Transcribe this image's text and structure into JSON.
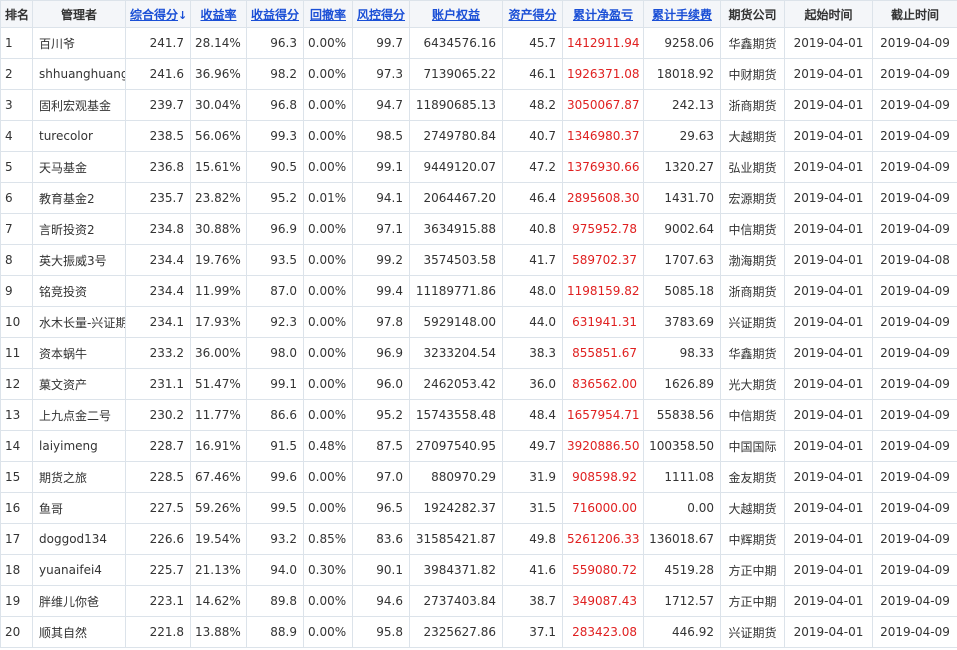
{
  "headers": {
    "rank": "排名",
    "manager": "管理者",
    "score": "综合得分",
    "return_rate": "收益率",
    "return_score": "收益得分",
    "drawdown": "回撤率",
    "risk_score": "风控得分",
    "equity": "账户权益",
    "asset_score": "资产得分",
    "profit": "累计净盈亏",
    "fees": "累计手续费",
    "broker": "期货公司",
    "start": "起始时间",
    "end": "截止时间",
    "sort_arrow": "↓"
  },
  "colors": {
    "link": "#1a4fd6",
    "profit": "#e02020",
    "grid": "#dce3ea"
  },
  "rows": [
    {
      "rank": "1",
      "manager": "百川爷",
      "score": "241.7",
      "return_rate": "28.14%",
      "return_score": "96.3",
      "drawdown": "0.00%",
      "risk_score": "99.7",
      "equity": "6434576.16",
      "asset_score": "45.7",
      "profit": "1412911.94",
      "fees": "9258.06",
      "broker": "华鑫期货",
      "start": "2019-04-01",
      "end": "2019-04-09"
    },
    {
      "rank": "2",
      "manager": "shhuanghuang",
      "score": "241.6",
      "return_rate": "36.96%",
      "return_score": "98.2",
      "drawdown": "0.00%",
      "risk_score": "97.3",
      "equity": "7139065.22",
      "asset_score": "46.1",
      "profit": "1926371.08",
      "fees": "18018.92",
      "broker": "中财期货",
      "start": "2019-04-01",
      "end": "2019-04-09"
    },
    {
      "rank": "3",
      "manager": "固利宏观基金",
      "score": "239.7",
      "return_rate": "30.04%",
      "return_score": "96.8",
      "drawdown": "0.00%",
      "risk_score": "94.7",
      "equity": "11890685.13",
      "asset_score": "48.2",
      "profit": "3050067.87",
      "fees": "242.13",
      "broker": "浙商期货",
      "start": "2019-04-01",
      "end": "2019-04-09"
    },
    {
      "rank": "4",
      "manager": "turecolor",
      "score": "238.5",
      "return_rate": "56.06%",
      "return_score": "99.3",
      "drawdown": "0.00%",
      "risk_score": "98.5",
      "equity": "2749780.84",
      "asset_score": "40.7",
      "profit": "1346980.37",
      "fees": "29.63",
      "broker": "大越期货",
      "start": "2019-04-01",
      "end": "2019-04-09"
    },
    {
      "rank": "5",
      "manager": "天马基金",
      "score": "236.8",
      "return_rate": "15.61%",
      "return_score": "90.5",
      "drawdown": "0.00%",
      "risk_score": "99.1",
      "equity": "9449120.07",
      "asset_score": "47.2",
      "profit": "1376930.66",
      "fees": "1320.27",
      "broker": "弘业期货",
      "start": "2019-04-01",
      "end": "2019-04-09"
    },
    {
      "rank": "6",
      "manager": "教育基金2",
      "score": "235.7",
      "return_rate": "23.82%",
      "return_score": "95.2",
      "drawdown": "0.01%",
      "risk_score": "94.1",
      "equity": "2064467.20",
      "asset_score": "46.4",
      "profit": "2895608.30",
      "fees": "1431.70",
      "broker": "宏源期货",
      "start": "2019-04-01",
      "end": "2019-04-09"
    },
    {
      "rank": "7",
      "manager": "言昕投资2",
      "score": "234.8",
      "return_rate": "30.88%",
      "return_score": "96.9",
      "drawdown": "0.00%",
      "risk_score": "97.1",
      "equity": "3634915.88",
      "asset_score": "40.8",
      "profit": "975952.78",
      "fees": "9002.64",
      "broker": "中信期货",
      "start": "2019-04-01",
      "end": "2019-04-09"
    },
    {
      "rank": "8",
      "manager": "英大振威3号",
      "score": "234.4",
      "return_rate": "19.76%",
      "return_score": "93.5",
      "drawdown": "0.00%",
      "risk_score": "99.2",
      "equity": "3574503.58",
      "asset_score": "41.7",
      "profit": "589702.37",
      "fees": "1707.63",
      "broker": "渤海期货",
      "start": "2019-04-01",
      "end": "2019-04-08"
    },
    {
      "rank": "9",
      "manager": "铭竞投资",
      "score": "234.4",
      "return_rate": "11.99%",
      "return_score": "87.0",
      "drawdown": "0.00%",
      "risk_score": "99.4",
      "equity": "11189771.86",
      "asset_score": "48.0",
      "profit": "1198159.82",
      "fees": "5085.18",
      "broker": "浙商期货",
      "start": "2019-04-01",
      "end": "2019-04-09"
    },
    {
      "rank": "10",
      "manager": "水木长量-兴证期",
      "score": "234.1",
      "return_rate": "17.93%",
      "return_score": "92.3",
      "drawdown": "0.00%",
      "risk_score": "97.8",
      "equity": "5929148.00",
      "asset_score": "44.0",
      "profit": "631941.31",
      "fees": "3783.69",
      "broker": "兴证期货",
      "start": "2019-04-01",
      "end": "2019-04-09"
    },
    {
      "rank": "11",
      "manager": "资本蜗牛",
      "score": "233.2",
      "return_rate": "36.00%",
      "return_score": "98.0",
      "drawdown": "0.00%",
      "risk_score": "96.9",
      "equity": "3233204.54",
      "asset_score": "38.3",
      "profit": "855851.67",
      "fees": "98.33",
      "broker": "华鑫期货",
      "start": "2019-04-01",
      "end": "2019-04-09"
    },
    {
      "rank": "12",
      "manager": "菓文资产",
      "score": "231.1",
      "return_rate": "51.47%",
      "return_score": "99.1",
      "drawdown": "0.00%",
      "risk_score": "96.0",
      "equity": "2462053.42",
      "asset_score": "36.0",
      "profit": "836562.00",
      "fees": "1626.89",
      "broker": "光大期货",
      "start": "2019-04-01",
      "end": "2019-04-09"
    },
    {
      "rank": "13",
      "manager": "上九点金二号",
      "score": "230.2",
      "return_rate": "11.77%",
      "return_score": "86.6",
      "drawdown": "0.00%",
      "risk_score": "95.2",
      "equity": "15743558.48",
      "asset_score": "48.4",
      "profit": "1657954.71",
      "fees": "55838.56",
      "broker": "中信期货",
      "start": "2019-04-01",
      "end": "2019-04-09"
    },
    {
      "rank": "14",
      "manager": "laiyimeng",
      "score": "228.7",
      "return_rate": "16.91%",
      "return_score": "91.5",
      "drawdown": "0.48%",
      "risk_score": "87.5",
      "equity": "27097540.95",
      "asset_score": "49.7",
      "profit": "3920886.50",
      "fees": "100358.50",
      "broker": "中国国际",
      "start": "2019-04-01",
      "end": "2019-04-09"
    },
    {
      "rank": "15",
      "manager": "期货之旅",
      "score": "228.5",
      "return_rate": "67.46%",
      "return_score": "99.6",
      "drawdown": "0.00%",
      "risk_score": "97.0",
      "equity": "880970.29",
      "asset_score": "31.9",
      "profit": "908598.92",
      "fees": "1111.08",
      "broker": "金友期货",
      "start": "2019-04-01",
      "end": "2019-04-09"
    },
    {
      "rank": "16",
      "manager": "鱼哥",
      "score": "227.5",
      "return_rate": "59.26%",
      "return_score": "99.5",
      "drawdown": "0.00%",
      "risk_score": "96.5",
      "equity": "1924282.37",
      "asset_score": "31.5",
      "profit": "716000.00",
      "fees": "0.00",
      "broker": "大越期货",
      "start": "2019-04-01",
      "end": "2019-04-09"
    },
    {
      "rank": "17",
      "manager": "doggod134",
      "score": "226.6",
      "return_rate": "19.54%",
      "return_score": "93.2",
      "drawdown": "0.85%",
      "risk_score": "83.6",
      "equity": "31585421.87",
      "asset_score": "49.8",
      "profit": "5261206.33",
      "fees": "136018.67",
      "broker": "中辉期货",
      "start": "2019-04-01",
      "end": "2019-04-09"
    },
    {
      "rank": "18",
      "manager": "yuanaifei4",
      "score": "225.7",
      "return_rate": "21.13%",
      "return_score": "94.0",
      "drawdown": "0.30%",
      "risk_score": "90.1",
      "equity": "3984371.82",
      "asset_score": "41.6",
      "profit": "559080.72",
      "fees": "4519.28",
      "broker": "方正中期",
      "start": "2019-04-01",
      "end": "2019-04-09"
    },
    {
      "rank": "19",
      "manager": "胖维儿你爸",
      "score": "223.1",
      "return_rate": "14.62%",
      "return_score": "89.8",
      "drawdown": "0.00%",
      "risk_score": "94.6",
      "equity": "2737403.84",
      "asset_score": "38.7",
      "profit": "349087.43",
      "fees": "1712.57",
      "broker": "方正中期",
      "start": "2019-04-01",
      "end": "2019-04-09"
    },
    {
      "rank": "20",
      "manager": "顺其自然",
      "score": "221.8",
      "return_rate": "13.88%",
      "return_score": "88.9",
      "drawdown": "0.00%",
      "risk_score": "95.8",
      "equity": "2325627.86",
      "asset_score": "37.1",
      "profit": "283423.08",
      "fees": "446.92",
      "broker": "兴证期货",
      "start": "2019-04-01",
      "end": "2019-04-09"
    }
  ]
}
